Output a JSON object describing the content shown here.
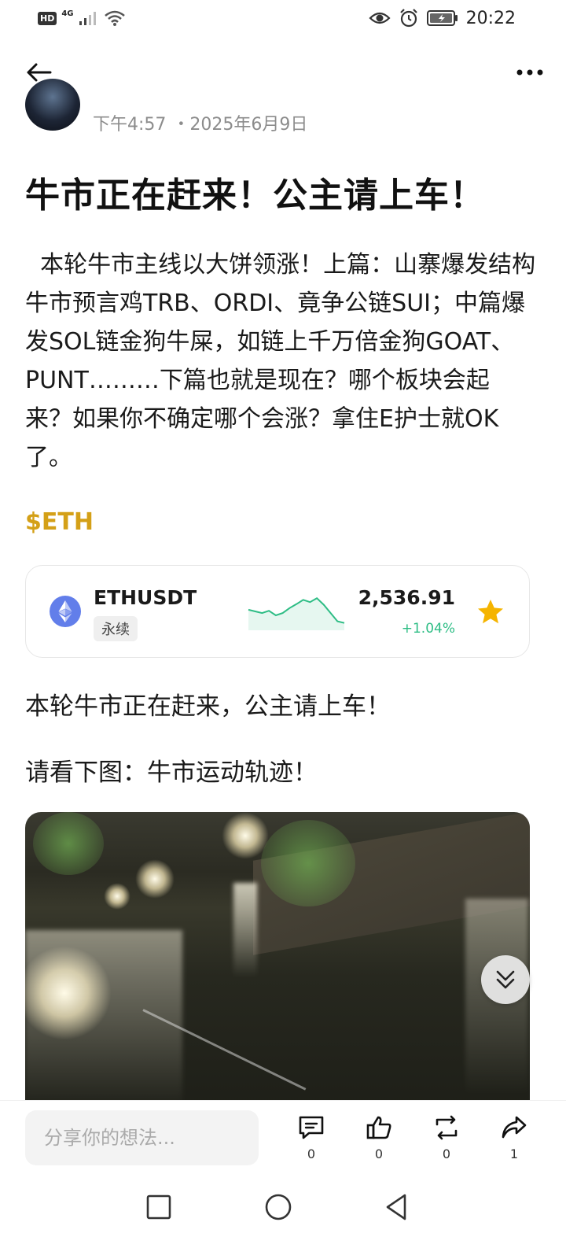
{
  "status_bar": {
    "hd": "HD",
    "network": "4G",
    "time": "20:22"
  },
  "author": {
    "time": "下午4:57",
    "date": "・2025年6月9日"
  },
  "post": {
    "title": "牛市正在赶来！公主请上车！",
    "body": "  本轮牛市主线以大饼领涨！上篇：山寨爆发结构牛市预言鸡TRB、ORDI、竟争公链SUI；中篇爆发SOL链金狗牛屎，如链上千万倍金狗GOAT、PUNT………下篇也就是现在？哪个板块会起来？如果你不确定哪个会涨？拿住E护士就OK了。",
    "cashtag": "$ETH",
    "paragraph_1": "本轮牛市正在赶来，公主请上车！",
    "paragraph_2": "请看下图：牛市运动轨迹！"
  },
  "ticker": {
    "symbol": "ETHUSDT",
    "type": "永续",
    "price": "2,536.91",
    "change": "+1.04%",
    "change_color": "#2ebd85",
    "logo_icon": "ethereum-icon",
    "favorite_icon": "star-icon",
    "favorite_color": "#f5b400",
    "sparkline_trend": [
      0.55,
      0.5,
      0.45,
      0.52,
      0.38,
      0.45,
      0.6,
      0.72,
      0.85,
      0.78,
      0.9,
      0.7,
      0.45,
      0.2,
      0.15
    ]
  },
  "comment_bar": {
    "placeholder": "分享你的想法...",
    "comments_count": "0",
    "likes_count": "0",
    "reposts_count": "0",
    "shares_count": "1"
  },
  "colors": {
    "cashtag": "#d4a017",
    "eth_logo": "#627eea"
  }
}
